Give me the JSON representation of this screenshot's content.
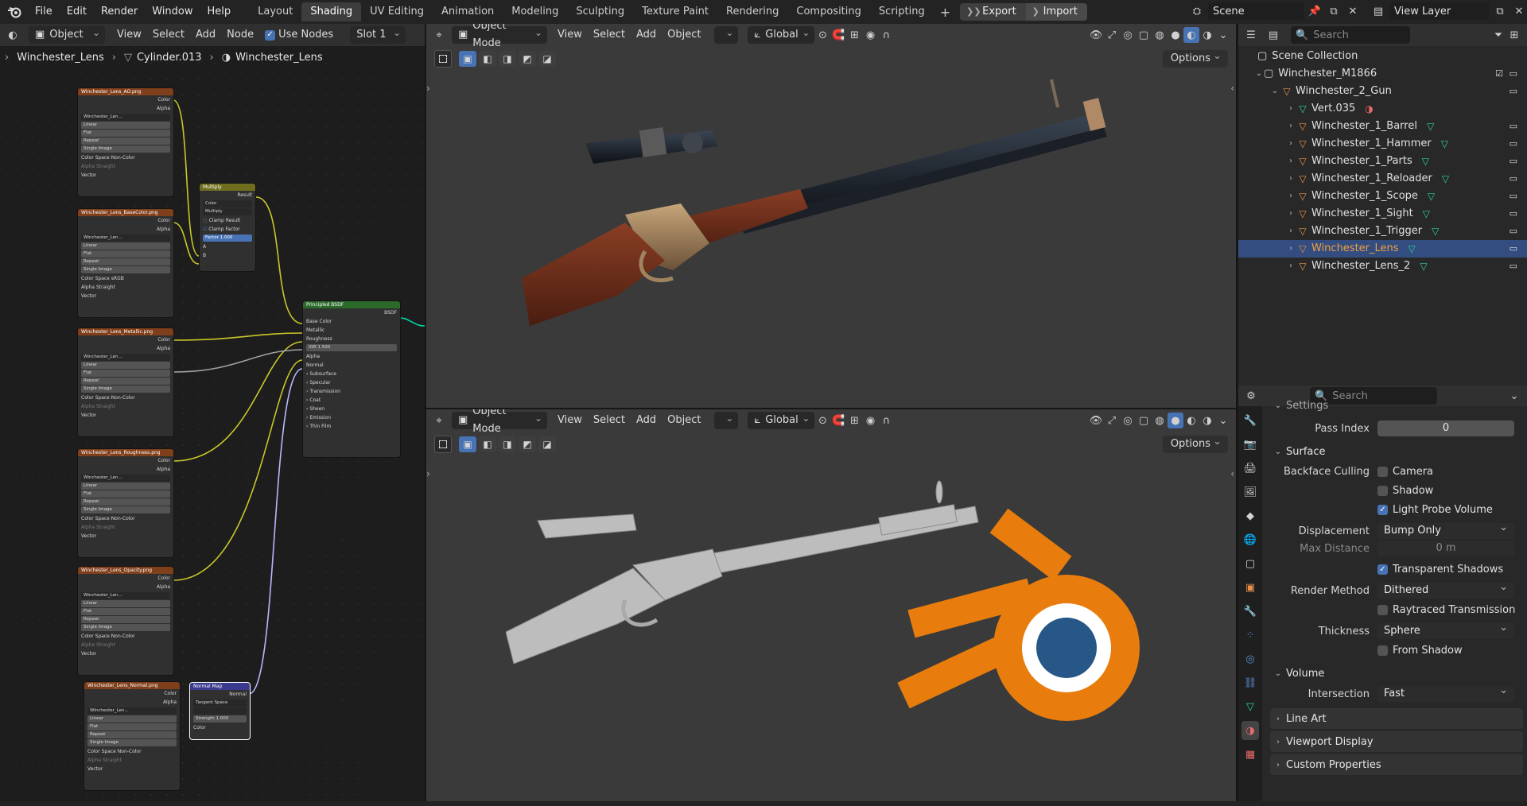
{
  "menubar": {
    "items": [
      "File",
      "Edit",
      "Render",
      "Window",
      "Help"
    ],
    "workspaces": [
      "Layout",
      "Shading",
      "UV Editing",
      "Animation",
      "Modeling",
      "Sculpting",
      "Texture Paint",
      "Rendering",
      "Compositing",
      "Scripting"
    ],
    "active_workspace": "Shading",
    "export_label": "Export",
    "import_label": "Import",
    "scene_name": "Scene",
    "view_layer": "View Layer"
  },
  "node_editor": {
    "header": {
      "object_mode": "Object",
      "menus": [
        "View",
        "Select",
        "Add",
        "Node"
      ],
      "use_nodes_label": "Use Nodes",
      "slot": "Slot 1"
    },
    "breadcrumb": [
      "Winchester_Lens",
      "Cylinder.013",
      "Winchester_Lens"
    ],
    "texture_nodes": [
      {
        "title": "Winchester_Lens_AO.png",
        "image": "Winchester_Len...",
        "interp": "Linear",
        "proj": "Flat",
        "ext": "Repeat",
        "src": "Single Image",
        "colorspace": "Non-Color",
        "alpha": "Straight"
      },
      {
        "title": "Winchester_Lens_BaseColor.png",
        "image": "Winchester_Len...",
        "interp": "Linear",
        "proj": "Flat",
        "ext": "Repeat",
        "src": "Single Image",
        "colorspace": "sRGB",
        "alpha": "Straight"
      },
      {
        "title": "Winchester_Lens_Metallic.png",
        "image": "Winchester_Len...",
        "interp": "Linear",
        "proj": "Flat",
        "ext": "Repeat",
        "src": "Single Image",
        "colorspace": "Non-Color",
        "alpha": "Straight"
      },
      {
        "title": "Winchester_Lens_Roughness.png",
        "image": "Winchester_Len...",
        "interp": "Linear",
        "proj": "Flat",
        "ext": "Repeat",
        "src": "Single Image",
        "colorspace": "Non-Color",
        "alpha": "Straight"
      },
      {
        "title": "Winchester_Lens_Opacity.png",
        "image": "Winchester_Len...",
        "interp": "Linear",
        "proj": "Flat",
        "ext": "Repeat",
        "src": "Single Image",
        "colorspace": "Non-Color",
        "alpha": "Straight"
      },
      {
        "title": "Winchester_Lens_Normal.png",
        "image": "Winchester_Len...",
        "interp": "Linear",
        "proj": "Flat",
        "ext": "Repeat",
        "src": "Single Image",
        "colorspace": "Non-Color",
        "alpha": "Straight"
      }
    ],
    "tex_labels": {
      "color": "Color",
      "alpha": "Alpha",
      "vector": "Vector",
      "colorspace": "Color Space",
      "alpha_mode": "Alpha"
    },
    "multiply_node": {
      "title": "Multiply",
      "result": "Result",
      "type": "Color",
      "blend": "Multiply",
      "clamp_result": "Clamp Result",
      "clamp_factor": "Clamp Factor",
      "factor_label": "Factor",
      "factor": "1.000",
      "a": "A",
      "b": "B"
    },
    "bsdf_node": {
      "title": "Principled BSDF",
      "out": "BSDF",
      "inputs": [
        "Base Color",
        "Metallic",
        "Roughness"
      ],
      "ior_label": "IOR",
      "ior": "1.500",
      "inputs2": [
        "Alpha",
        "Normal"
      ],
      "subpanels": [
        "Subsurface",
        "Specular",
        "Transmission",
        "Coat",
        "Sheen",
        "Emission",
        "Thin Film"
      ]
    },
    "normal_node": {
      "title": "Normal Map",
      "out": "Normal",
      "space": "Tangent Space",
      "strength_label": "Strength",
      "strength": "1.000",
      "color": "Color"
    }
  },
  "viewport": {
    "mode": "Object Mode",
    "menus": [
      "View",
      "Select",
      "Add",
      "Object"
    ],
    "orientation": "Global",
    "options": "Options"
  },
  "outliner": {
    "search_placeholder": "Search",
    "root": "Scene Collection",
    "collection": "Winchester_M1866",
    "parent": "Winchester_2_Gun",
    "items": [
      "Vert.035",
      "Winchester_1_Barrel",
      "Winchester_1_Hammer",
      "Winchester_1_Parts",
      "Winchester_1_Reloader",
      "Winchester_1_Scope",
      "Winchester_1_Sight",
      "Winchester_1_Trigger",
      "Winchester_Lens",
      "Winchester_Lens_2"
    ],
    "selected": "Winchester_Lens"
  },
  "properties": {
    "search_placeholder": "Search",
    "settings_label": "Settings",
    "pass_index_label": "Pass Index",
    "pass_index": "0",
    "surface_label": "Surface",
    "backface_culling_label": "Backface Culling",
    "camera_label": "Camera",
    "shadow_label": "Shadow",
    "light_probe_label": "Light Probe Volume",
    "displacement_label": "Displacement",
    "displacement": "Bump Only",
    "max_distance_label": "Max Distance",
    "max_distance": "0 m",
    "transparent_shadows_label": "Transparent Shadows",
    "render_method_label": "Render Method",
    "render_method": "Dithered",
    "raytraced_label": "Raytraced Transmission",
    "thickness_label": "Thickness",
    "thickness": "Sphere",
    "from_shadow_label": "From Shadow",
    "volume_label": "Volume",
    "intersection_label": "Intersection",
    "intersection": "Fast",
    "collapsed_panels": [
      "Line Art",
      "Viewport Display",
      "Custom Properties"
    ]
  },
  "colors": {
    "accent_blue": "#4772b3",
    "selection_orange": "#f0a040",
    "blender_logo_orange": "#e87d0d",
    "blender_logo_blue": "#265787"
  }
}
